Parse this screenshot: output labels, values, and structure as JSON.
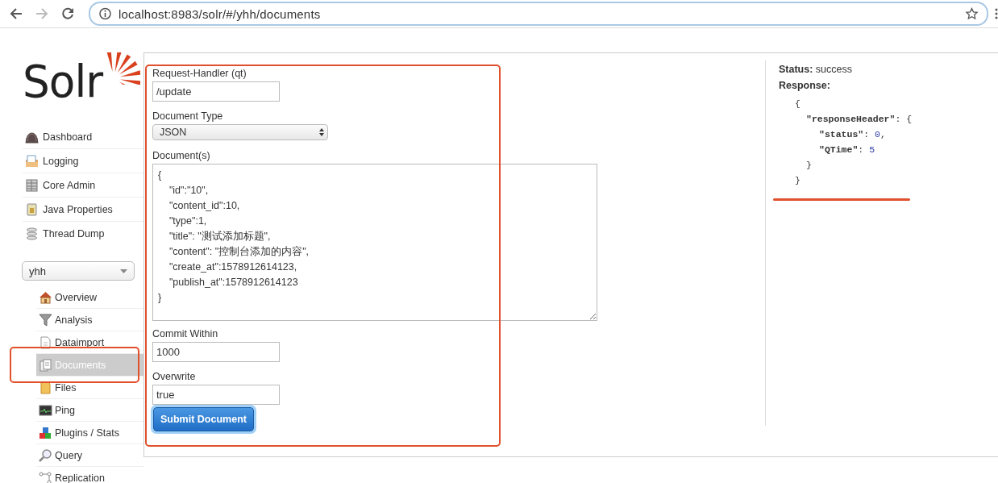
{
  "browser": {
    "url": "localhost:8983/solr/#/yhh/documents",
    "back_disabled": false,
    "forward_disabled": true
  },
  "logo": {
    "text": "Solr"
  },
  "sidebar": {
    "items": [
      {
        "label": "Dashboard"
      },
      {
        "label": "Logging"
      },
      {
        "label": "Core Admin"
      },
      {
        "label": "Java Properties"
      },
      {
        "label": "Thread Dump"
      }
    ],
    "core_selector": {
      "value": "yhh"
    },
    "core_items": [
      {
        "label": "Overview",
        "selected": false
      },
      {
        "label": "Analysis",
        "selected": false
      },
      {
        "label": "Dataimport",
        "selected": false
      },
      {
        "label": "Documents",
        "selected": true
      },
      {
        "label": "Files",
        "selected": false
      },
      {
        "label": "Ping",
        "selected": false
      },
      {
        "label": "Plugins / Stats",
        "selected": false
      },
      {
        "label": "Query",
        "selected": false
      },
      {
        "label": "Replication",
        "selected": false
      }
    ]
  },
  "form": {
    "request_handler": {
      "label": "Request-Handler (qt)",
      "value": "/update"
    },
    "document_type": {
      "label": "Document Type",
      "value": "JSON"
    },
    "documents": {
      "label": "Document(s)",
      "lines": [
        "{",
        "\t\"id\":\"10\",",
        "\t\"content_id\":10,",
        "\t\"type\":1,",
        "\t\"title\": \"测试添加标题\",",
        "\t\"content\": \"控制台添加的内容\",",
        "\t\"create_at\":1578912614123,",
        "\t\"publish_at\":1578912614123",
        "}"
      ]
    },
    "commit_within": {
      "label": "Commit Within",
      "value": "1000"
    },
    "overwrite": {
      "label": "Overwrite",
      "value": "true"
    },
    "submit": {
      "label": "Submit Document"
    }
  },
  "response": {
    "status_label": "Status:",
    "status": "success",
    "response_label": "Response:",
    "json": {
      "open": "{",
      "close": "}",
      "children": [
        {
          "key": "\"responseHeader\"",
          "sep": ": ",
          "open": "{",
          "close": "}",
          "children": [
            {
              "key": "\"status\"",
              "sep": ": ",
              "value": "0",
              "trail": ","
            },
            {
              "key": "\"QTime\"",
              "sep": ": ",
              "value": "5"
            }
          ]
        }
      ]
    }
  }
}
